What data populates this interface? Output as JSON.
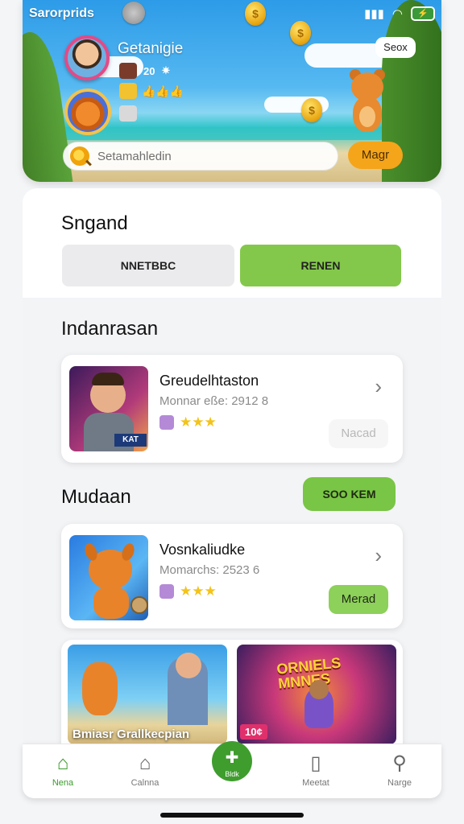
{
  "status": {
    "app_title": "Sarorprids",
    "battery_label": ""
  },
  "hero": {
    "user_name": "Getanigie",
    "level": "20",
    "tag_label": "Seox",
    "search_placeholder": "Setamahledin",
    "search_button": "Magr"
  },
  "section1": {
    "title": "Sngand",
    "btn_left": "NNETBBC",
    "btn_right": "RENEN"
  },
  "section2": {
    "title": "Indanrasan",
    "card": {
      "title": "Greudelhtaston",
      "subtitle": "Monnar eße:  2912 8",
      "stars": "★★★",
      "button": "Nacad"
    }
  },
  "section3": {
    "title": "Mudaan",
    "header_button": "SOO KEM",
    "card": {
      "title": "Vosnkaliudke",
      "subtitle": "Momarchs:  2523 6",
      "stars": "★★★",
      "button": "Merad"
    }
  },
  "gallery": {
    "tile1_caption": "Bmiasr Grallkecpian",
    "tile2_headline": "ORNIELS MNNES",
    "tile2_price": "10¢"
  },
  "tabbar": {
    "items": [
      {
        "label": "Nena",
        "icon": "home-icon"
      },
      {
        "label": "Calnna",
        "icon": "house-outline-icon"
      },
      {
        "label": "Bldk",
        "icon": "center-action-icon"
      },
      {
        "label": "Meetat",
        "icon": "book-icon"
      },
      {
        "label": "Narge",
        "icon": "search-icon"
      }
    ]
  },
  "colors": {
    "accent_green": "#79c545",
    "dark_green": "#3f9d2e",
    "orange": "#f5a51a",
    "star_yellow": "#f3c31b"
  }
}
